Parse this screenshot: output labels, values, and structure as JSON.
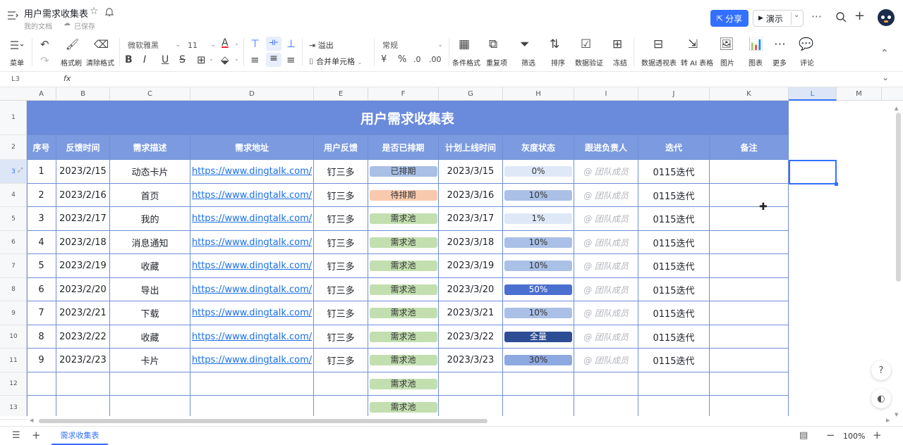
{
  "doc": {
    "title": "用户需求收集表",
    "location": "我的文档",
    "save_status": "已保存"
  },
  "header_actions": {
    "share": "分享",
    "present": "演示"
  },
  "toolbar": {
    "menu": "菜单",
    "format_painter": "格式刷",
    "clear_format": "清除格式",
    "font_family": "微软雅黑",
    "font_size": "11",
    "overflow": "溢出",
    "merge_cells": "合并单元格",
    "number_format": "常规",
    "cond_format": "条件格式",
    "duplicates": "重复项",
    "filter": "筛选",
    "sort": "排序",
    "validation": "数据验证",
    "freeze": "冻结",
    "pivot": "数据透视表",
    "ai_table": "转 AI 表格",
    "image": "图片",
    "chart": "图表",
    "more": "更多",
    "comment": "评论"
  },
  "formula_bar": {
    "cell_ref": "L3",
    "fx": "fx"
  },
  "columns": [
    "A",
    "B",
    "C",
    "D",
    "E",
    "F",
    "G",
    "H",
    "I",
    "J",
    "K",
    "L",
    "M"
  ],
  "rows": [
    "1",
    "2",
    "3",
    "4",
    "5",
    "6",
    "7",
    "8",
    "9",
    "10",
    "11",
    "12",
    "13"
  ],
  "sheet": {
    "title": "用户需求收集表",
    "headers": [
      "序号",
      "反馈时间",
      "需求描述",
      "需求地址",
      "用户反馈",
      "是否已排期",
      "计划上线时间",
      "灰度状态",
      "跟进负责人",
      "迭代",
      "备注"
    ],
    "rows": [
      {
        "no": "1",
        "date": "2023/2/15",
        "desc": "动态卡片",
        "url": "https://www.dingtalk.com/",
        "user": "钉三多",
        "sched": "已排期",
        "plan": "2023/3/15",
        "gray": "0%",
        "owner": "@ 团队成员",
        "iter": "0115迭代"
      },
      {
        "no": "2",
        "date": "2023/2/16",
        "desc": "首页",
        "url": "https://www.dingtalk.com/",
        "user": "钉三多",
        "sched": "待排期",
        "plan": "2023/3/16",
        "gray": "10%",
        "owner": "@ 团队成员",
        "iter": "0115迭代"
      },
      {
        "no": "3",
        "date": "2023/2/17",
        "desc": "我的",
        "url": "https://www.dingtalk.com/",
        "user": "钉三多",
        "sched": "需求池",
        "plan": "2023/3/17",
        "gray": "1%",
        "owner": "@ 团队成员",
        "iter": "0115迭代"
      },
      {
        "no": "4",
        "date": "2023/2/18",
        "desc": "消息通知",
        "url": "https://www.dingtalk.com/",
        "user": "钉三多",
        "sched": "需求池",
        "plan": "2023/3/18",
        "gray": "10%",
        "owner": "@ 团队成员",
        "iter": "0115迭代"
      },
      {
        "no": "5",
        "date": "2023/2/19",
        "desc": "收藏",
        "url": "https://www.dingtalk.com/",
        "user": "钉三多",
        "sched": "需求池",
        "plan": "2023/3/19",
        "gray": "10%",
        "owner": "@ 团队成员",
        "iter": "0115迭代"
      },
      {
        "no": "6",
        "date": "2023/2/20",
        "desc": "导出",
        "url": "https://www.dingtalk.com/",
        "user": "钉三多",
        "sched": "需求池",
        "plan": "2023/3/20",
        "gray": "50%",
        "owner": "@ 团队成员",
        "iter": "0115迭代"
      },
      {
        "no": "7",
        "date": "2023/2/21",
        "desc": "下载",
        "url": "https://www.dingtalk.com/",
        "user": "钉三多",
        "sched": "需求池",
        "plan": "2023/3/21",
        "gray": "10%",
        "owner": "@ 团队成员",
        "iter": "0115迭代"
      },
      {
        "no": "8",
        "date": "2023/2/22",
        "desc": "收藏",
        "url": "https://www.dingtalk.com/",
        "user": "钉三多",
        "sched": "需求池",
        "plan": "2023/3/22",
        "gray": "全量",
        "owner": "@ 团队成员",
        "iter": "0115迭代"
      },
      {
        "no": "9",
        "date": "2023/2/23",
        "desc": "卡片",
        "url": "https://www.dingtalk.com/",
        "user": "钉三多",
        "sched": "需求池",
        "plan": "2023/3/23",
        "gray": "30%",
        "owner": "@ 团队成员",
        "iter": "0115迭代"
      },
      {
        "no": "",
        "date": "",
        "desc": "",
        "url": "",
        "user": "",
        "sched": "需求池",
        "plan": "",
        "gray": "",
        "owner": "",
        "iter": ""
      },
      {
        "no": "",
        "date": "",
        "desc": "",
        "url": "",
        "user": "",
        "sched": "需求池",
        "plan": "",
        "gray": "",
        "owner": "",
        "iter": ""
      }
    ]
  },
  "status_colors": {
    "已排期": "#a9bfe6",
    "待排期": "#f9c9ad",
    "需求池": "#c3dfb0",
    "0%": "#dfe8f7",
    "1%": "#dfe8f7",
    "10%": "#aac0e6",
    "30%": "#8ea8e0",
    "50%": "#4a6fcf",
    "全量": "#2d4d94"
  },
  "footer": {
    "sheet_tab": "需求收集表",
    "zoom": "100%"
  }
}
